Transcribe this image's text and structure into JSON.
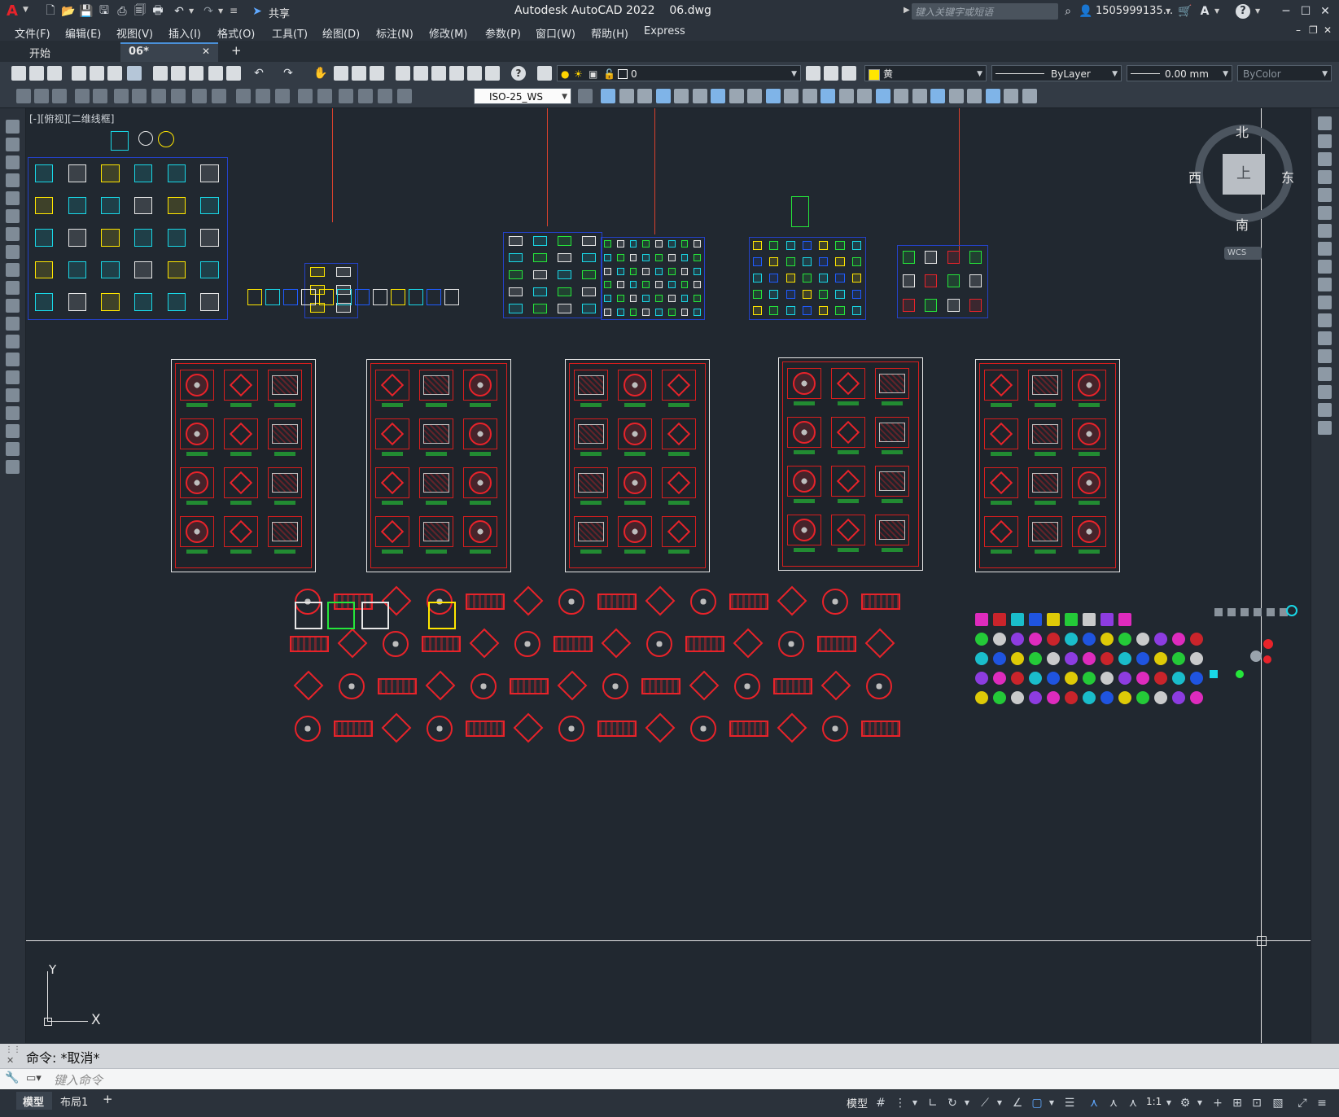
{
  "app": {
    "logo": "A",
    "title": "Autodesk AutoCAD 2022    06.dwg",
    "share_label": "共享",
    "search_placeholder": "键入关键字或短语",
    "user": "1505999135...",
    "help": "?"
  },
  "menu": [
    "文件(F)",
    "编辑(E)",
    "视图(V)",
    "插入(I)",
    "格式(O)",
    "工具(T)",
    "绘图(D)",
    "标注(N)",
    "修改(M)",
    "参数(P)",
    "窗口(W)",
    "帮助(H)",
    "Express"
  ],
  "tabs": [
    {
      "label": "开始",
      "active": false
    },
    {
      "label": "06*",
      "active": true
    }
  ],
  "toolbar": {
    "layer": "0",
    "color": "黄",
    "linetype": "ByLayer",
    "lineweight": "0.00 mm",
    "plotstyle": "ByColor",
    "dimstyle": "ISO-25_WS"
  },
  "viewport": {
    "label": "[-][俯视][二维线框]",
    "viewcube": {
      "north": "北",
      "south": "南",
      "east": "东",
      "west": "西",
      "top": "上",
      "wcs": "WCS"
    },
    "ucs": {
      "x": "X",
      "y": "Y"
    }
  },
  "command": {
    "history": "命令: *取消*",
    "placeholder": "键入命令"
  },
  "layout_tabs": [
    "模型",
    "布局1",
    "+"
  ],
  "status": {
    "model": "模型",
    "scale": "1:1"
  },
  "colors": {
    "accent_red": "#e8232a",
    "sheet_red": "#d71e1e",
    "cyan": "#19d7e6",
    "green": "#25e63a",
    "blue_frame": "#2442c8",
    "canvas_bg": "#212830"
  }
}
